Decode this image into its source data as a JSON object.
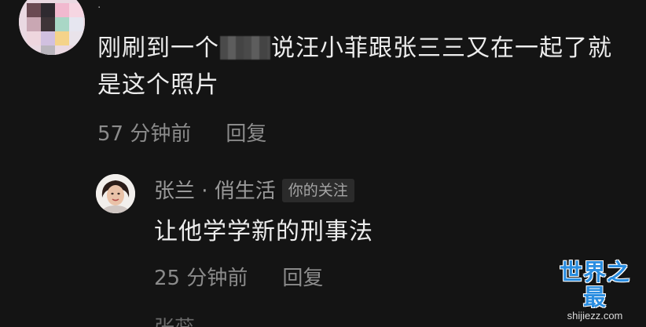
{
  "comment": {
    "username": "·",
    "text_before_mask": "刚刷到一个",
    "text_after_mask": "说汪小菲跟张三三又在一起了就是这个照片",
    "time": "57 分钟前",
    "reply_label": "回复"
  },
  "reply": {
    "author": "张兰 · 俏生活",
    "badge": "你的关注",
    "text": "让他学学新的刑事法",
    "time": "25 分钟前",
    "reply_label": "回复"
  },
  "next_reply_partial": "张蕊",
  "watermark": {
    "logo": "世界之最",
    "url": "shijiezz.com"
  },
  "colors": {
    "background": "#141414",
    "primary_text": "#ededed",
    "secondary_text": "#8b8b8b",
    "badge_bg": "#2b2b2b",
    "watermark_blue": "#2a8de0"
  },
  "icons": {
    "comment_avatar": "pixelated-avatar-icon",
    "reply_avatar": "user-avatar-icon"
  }
}
